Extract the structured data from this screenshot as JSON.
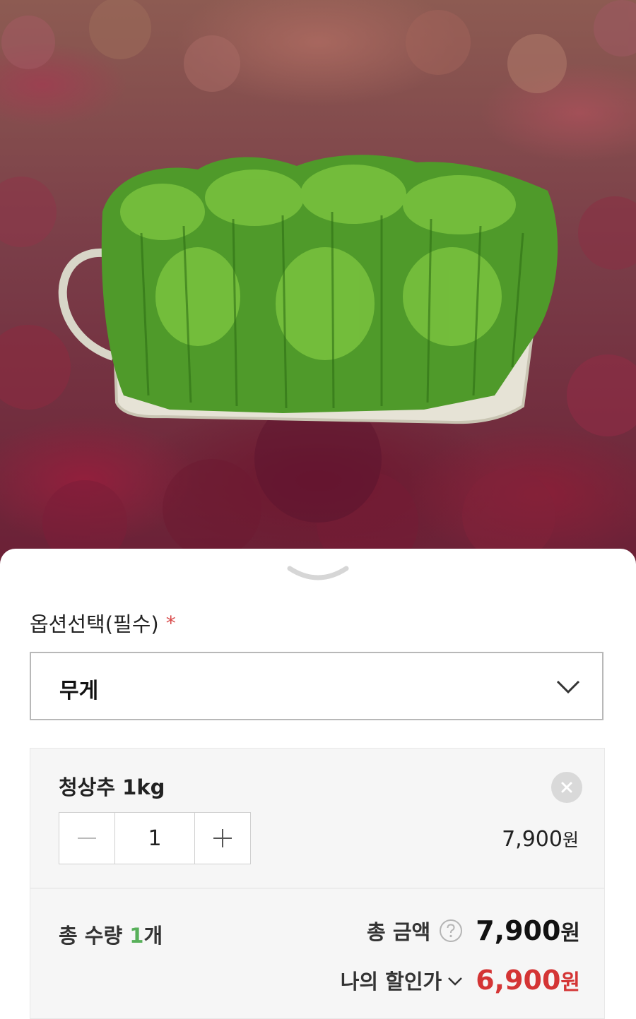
{
  "option_section": {
    "label": "옵션선택(필수)",
    "required_mark": "*",
    "select_value": "무게"
  },
  "selected_item": {
    "name": "청상추 1kg",
    "quantity": "1",
    "price": "7,900",
    "currency": "원"
  },
  "summary": {
    "quantity_label": "총 수량",
    "quantity_value": "1",
    "quantity_unit": "개",
    "total_label": "총 금액",
    "total_amount": "7,900",
    "currency": "원",
    "discount_label": "나의 할인가",
    "discount_amount": "6,900"
  },
  "colors": {
    "required": "#d94b4b",
    "quantity_accent": "#58b05a",
    "discount": "#d43535"
  },
  "icons": {
    "handle": "chevron-down-icon",
    "select": "chevron-down-icon",
    "remove": "close-icon",
    "decrease": "minus-icon",
    "increase": "plus-icon",
    "help": "question-icon",
    "discount_toggle": "chevron-down-icon"
  }
}
